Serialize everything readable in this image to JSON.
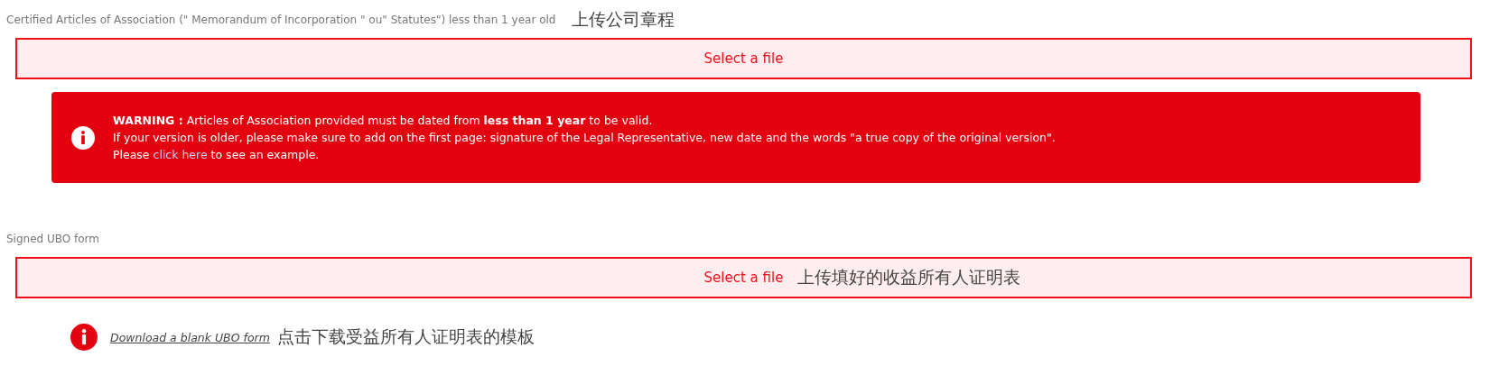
{
  "articles": {
    "label": "Certified Articles of Association (\" Memorandum of Incorporation \" ou\" Statutes\") less than 1 year old",
    "annotation": "上传公司章程",
    "upload": {
      "text": "Select a file"
    },
    "warning": {
      "lines": [
        "**WARNING :** Articles of Association provided must be dated from **less than 1 year** to be valid.",
        "If your version is older, please make sure to add on the first page: signature of the Legal Representative, new date and the words \"a true copy of the original version\"."
      ],
      "last_line": {
        "before": "Please",
        "link": "click here",
        "after": "to see an example."
      }
    }
  },
  "ubo": {
    "label": "Signed UBO form",
    "upload": {
      "text": "Select a file",
      "annotation": "上传填好的收益所有人证明表"
    },
    "download": {
      "link": "Download a blank UBO form",
      "annotation": "点击下载受益所有人证明表的模板"
    }
  }
}
